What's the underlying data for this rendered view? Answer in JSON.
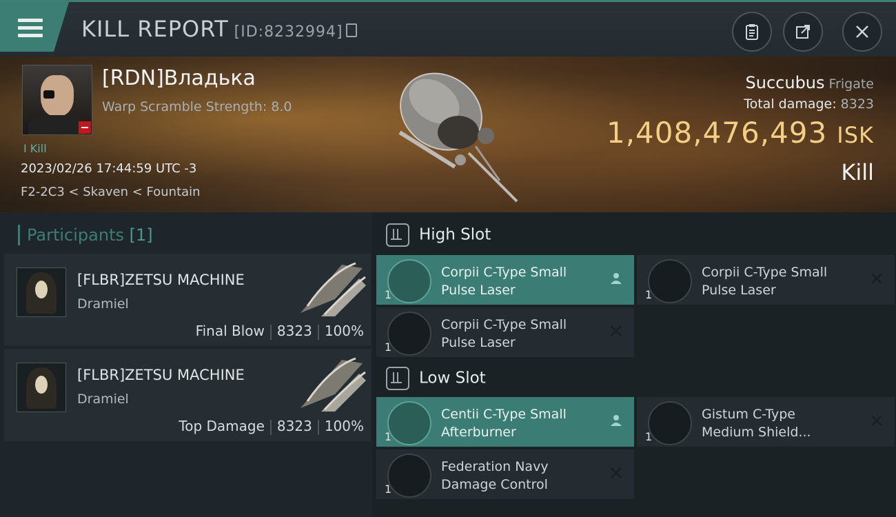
{
  "header": {
    "title": "KILL REPORT",
    "report_id": "[ID:8232994]"
  },
  "victim": {
    "name": "[RDN]Владька",
    "warp_scramble": "Warp Scramble Strength: 8.0",
    "kill_label": "I Kill",
    "timestamp": "2023/02/26 17:44:59 UTC -3",
    "location": "F2-2C3 < Skaven < Fountain"
  },
  "ship": {
    "name": "Succubus",
    "class": "Frigate",
    "total_damage_label": "Total damage:",
    "total_damage": "8323",
    "isk_value": "1,408,476,493",
    "isk_unit": "ISK",
    "result": "Kill"
  },
  "participants": {
    "label": "Participants",
    "count": "[1]",
    "items": [
      {
        "name": "[FLBR]ZETSU MACHINE",
        "ship": "Dramiel",
        "role": "Final Blow",
        "damage": "8323",
        "percent": "100%"
      },
      {
        "name": "[FLBR]ZETSU MACHINE",
        "ship": "Dramiel",
        "role": "Top Damage",
        "damage": "8323",
        "percent": "100%"
      }
    ]
  },
  "slots": {
    "high": {
      "label": "High Slot",
      "items": [
        {
          "line1": "Corpii C-Type Small",
          "line2": "Pulse Laser",
          "qty": "1",
          "status": "person-icon"
        },
        {
          "line1": "Corpii C-Type Small",
          "line2": "Pulse Laser",
          "qty": "1",
          "status": "x-icon"
        },
        {
          "line1": "Corpii C-Type Small",
          "line2": "Pulse Laser",
          "qty": "1",
          "status": "x-icon"
        }
      ]
    },
    "low": {
      "label": "Low Slot",
      "items": [
        {
          "line1": "Centii C-Type Small",
          "line2": "Afterburner",
          "qty": "1",
          "status": "person-icon"
        },
        {
          "line1": "Gistum C-Type",
          "line2": "Medium Shield...",
          "qty": "1",
          "status": "x-icon"
        },
        {
          "line1": "Federation Navy",
          "line2": "Damage Control",
          "qty": "1",
          "status": "x-icon"
        }
      ]
    }
  },
  "colors": {
    "accent": "#3c7d74",
    "isk": "#f3cf85",
    "loss_badge": "#c0191d"
  }
}
